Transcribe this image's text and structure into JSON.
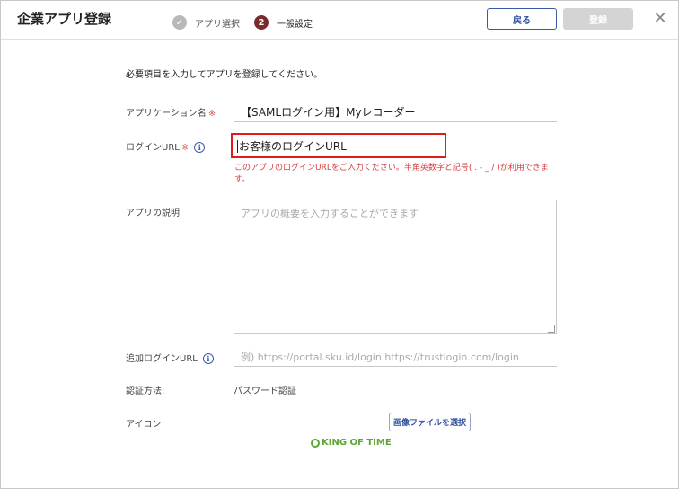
{
  "header": {
    "title": "企業アプリ登録",
    "steps": [
      {
        "marker": "✓",
        "label": "アプリ選択"
      },
      {
        "marker": "2",
        "label": "一般設定"
      }
    ],
    "back_label": "戻る",
    "register_label": "登録",
    "close_glyph": "✕"
  },
  "form": {
    "intro": "必要項目を入力してアプリを登録してください。",
    "required_mark": "※",
    "info_glyph": "i",
    "app_name": {
      "label": "アプリケーション名",
      "value": "【SAMLログイン用】Myレコーダー"
    },
    "login_url": {
      "label": "ログインURL",
      "value": "お客様のログインURL",
      "error": "このアプリのログインURLをご入力ください。半角英数字と記号( . - _ / )が利用できます。"
    },
    "description": {
      "label": "アプリの説明",
      "placeholder": "アプリの概要を入力することができます"
    },
    "additional_url": {
      "label": "追加ログインURL",
      "placeholder": "例) https://portal.sku.id/login https://trustlogin.com/login"
    },
    "auth_method": {
      "label": "認証方法:",
      "value": "パスワード認証"
    },
    "icon": {
      "label": "アイコン",
      "button_label": "画像ファイルを選択",
      "logo_text": "KING OF TIME"
    }
  },
  "colors": {
    "accent": "#2d4e9e",
    "error": "#d43f3f",
    "highlight": "#e01b1b",
    "step_active": "#7a2b2b",
    "logo_green": "#5aa832"
  }
}
